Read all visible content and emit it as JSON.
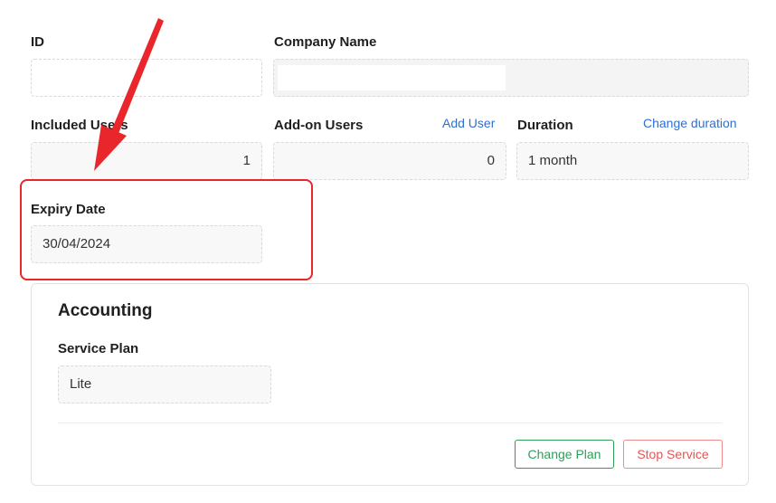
{
  "form": {
    "id": {
      "label": "ID",
      "value": ""
    },
    "company_name": {
      "label": "Company Name",
      "value": ""
    },
    "included_users": {
      "label": "Included Users",
      "value": "1"
    },
    "addon_users": {
      "label": "Add-on Users",
      "value": "0",
      "action": "Add User"
    },
    "duration": {
      "label": "Duration",
      "value": "1 month",
      "action": "Change duration"
    },
    "expiry_date": {
      "label": "Expiry Date",
      "value": "30/04/2024"
    }
  },
  "accounting": {
    "title": "Accounting",
    "service_plan_label": "Service Plan",
    "service_plan_value": "Lite",
    "change_plan_label": "Change Plan",
    "stop_service_label": "Stop Service"
  },
  "annotation": {
    "color": "#e8262b"
  },
  "colors": {
    "link": "#2f6fd0",
    "change_plan": "#2f9e5b",
    "stop_service": "#e85454"
  }
}
